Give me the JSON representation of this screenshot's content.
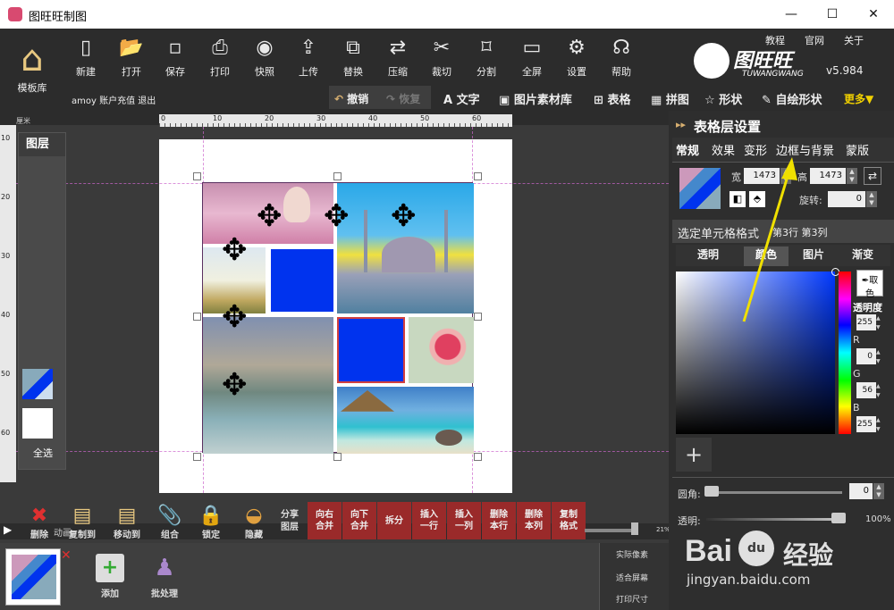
{
  "window": {
    "title": "图旺旺制图",
    "minimize": "—",
    "maximize": "☐",
    "close": "✕"
  },
  "toolbar": {
    "template": "模板库",
    "buttons": [
      "新建",
      "打开",
      "保存",
      "打印",
      "快照",
      "上传",
      "替换",
      "压缩",
      "裁切",
      "分割",
      "全屏",
      "设置",
      "帮助"
    ],
    "links": [
      "教程",
      "官网",
      "关于"
    ],
    "brand": "图旺旺",
    "brand_sub": "TUWANGWANG",
    "version": "v5.984",
    "user": "amoy",
    "recharge": "账户充值",
    "logout": "退出",
    "undo": "撤销",
    "redo": "恢复",
    "text": "文字",
    "images": "图片素材库",
    "table": "表格",
    "collage": "拼图",
    "shape": "形状",
    "freeform": "自绘形状",
    "more": "更多▼"
  },
  "ruler": {
    "unit": "厘米",
    "ticks": [
      "0",
      "10",
      "20",
      "30",
      "40",
      "50",
      "60"
    ],
    "left_ticks": [
      "10",
      "20",
      "30",
      "40",
      "50",
      "60"
    ]
  },
  "layers": {
    "title": "图层",
    "select_all": "全选"
  },
  "bottom": {
    "actions": [
      "删除",
      "复制到",
      "移动到",
      "组合",
      "锁定",
      "隐藏"
    ],
    "share": [
      "分享",
      "图层"
    ],
    "red_buttons": [
      "向右\n合并",
      "向下\n合并",
      "拆分",
      "插入\n一行",
      "插入\n一列",
      "删除\n本行",
      "删除\n本列",
      "复制\n格式"
    ],
    "zoom": "21%",
    "add": "添加",
    "batch": "批处理",
    "view": [
      "实际像素",
      "适合屏幕",
      "打印尺寸"
    ],
    "anim": "动画"
  },
  "panel": {
    "title": "表格层设置",
    "tabs": [
      "常规",
      "效果",
      "变形",
      "边框与背景",
      "蒙版"
    ],
    "width_label": "宽",
    "width": "1473",
    "height_label": "高",
    "height": "1473",
    "rotate_label": "旋转:",
    "rotate": "0",
    "cell_format": "选定单元格格式",
    "cell_pos": "第3行 第3列",
    "color_tabs": [
      "透明",
      "颜色",
      "图片",
      "渐变"
    ],
    "pick": "取色",
    "opacity_label": "透明度",
    "opacity": "255",
    "r_label": "R",
    "r": "0",
    "g_label": "G",
    "g": "56",
    "b_label": "B",
    "b": "255",
    "add": "+",
    "corner_label": "圆角:",
    "corner": "0",
    "transparency_label": "透明:",
    "transparency": "100%"
  },
  "watermark": {
    "brand": "Bai",
    "logo": "du",
    "cn": "经验",
    "url": "jingyan.baidu.com"
  },
  "colors": {
    "accent_yellow": "#f0d000",
    "cell_blue": "#0033ee",
    "red_btn": "#9a2a2a"
  }
}
